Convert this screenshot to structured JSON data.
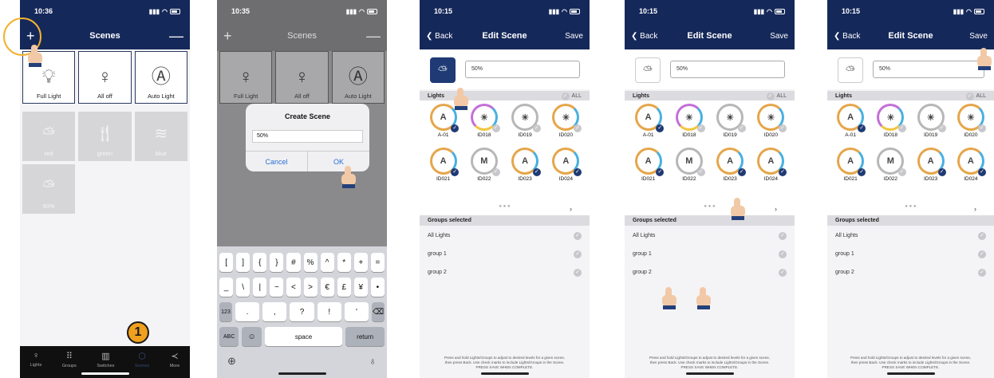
{
  "colors": {
    "nav": "#15285a",
    "accent": "#f0a01e",
    "link": "#2b6fd6"
  },
  "screen1": {
    "time": "10:36",
    "title": "Scenes",
    "add_icon": "+",
    "minus_icon": "—",
    "scenes": [
      {
        "label": "Full Light",
        "icon": "bulb-icon"
      },
      {
        "label": "All off",
        "icon": "bulb-off-icon"
      },
      {
        "label": "Auto Light",
        "icon": "auto-icon"
      }
    ],
    "custom_scenes": [
      {
        "label": "red",
        "icon": "sun-cloud-icon"
      },
      {
        "label": "green",
        "icon": "fork-knife-icon"
      },
      {
        "label": "blue",
        "icon": "pool-icon"
      },
      {
        "label": "50%",
        "icon": "sun-cloud-icon"
      }
    ],
    "tabs": [
      {
        "label": "Lights",
        "icon": "bulb-icon"
      },
      {
        "label": "Groups",
        "icon": "grid-icon"
      },
      {
        "label": "Switches",
        "icon": "switch-icon"
      },
      {
        "label": "Scenes",
        "icon": "scenes-icon"
      },
      {
        "label": "More",
        "icon": "share-icon"
      }
    ],
    "step_badge": "1"
  },
  "screen2": {
    "time": "10:35",
    "title": "Scenes",
    "dialog": {
      "title": "Create Scene",
      "value": "50%",
      "cancel": "Cancel",
      "ok": "OK"
    },
    "keyboard": {
      "row1": [
        "[",
        "]",
        "{",
        "}",
        "#",
        "%",
        "^",
        "*",
        "+",
        "="
      ],
      "row2": [
        "_",
        "\\",
        "|",
        "~",
        "<",
        ">",
        "€",
        "£",
        "¥",
        "•"
      ],
      "row3": [
        "123",
        ".",
        ",",
        "?",
        "!",
        "'",
        "⌫"
      ],
      "row4": [
        "ABC",
        "☺",
        "space",
        "return"
      ]
    }
  },
  "edit": {
    "time": "10:15",
    "back": "Back",
    "title": "Edit Scene",
    "save": "Save",
    "name_value": "50%",
    "lights_header": "Lights",
    "all_label": "ALL",
    "lights": [
      {
        "id": "A-01",
        "glyph": "A"
      },
      {
        "id": "ID018",
        "glyph": "☀"
      },
      {
        "id": "ID019",
        "glyph": "☀"
      },
      {
        "id": "ID020",
        "glyph": "☀"
      },
      {
        "id": "ID021",
        "glyph": "A"
      },
      {
        "id": "ID022",
        "glyph": "M"
      },
      {
        "id": "ID023",
        "glyph": "A"
      },
      {
        "id": "ID024",
        "glyph": "A"
      }
    ],
    "groups_header": "Groups selected",
    "groups": [
      "All Lights",
      "group 1",
      "group 2"
    ],
    "footer_line1": "Press and hold Lights/Groups to adjust to desired levels for a given scene,",
    "footer_line2": "then press Back. Use check marks to include Lights/Groups in the Scene.",
    "footer_line3": "PRESS SAVE WHEN COMPLETE."
  }
}
